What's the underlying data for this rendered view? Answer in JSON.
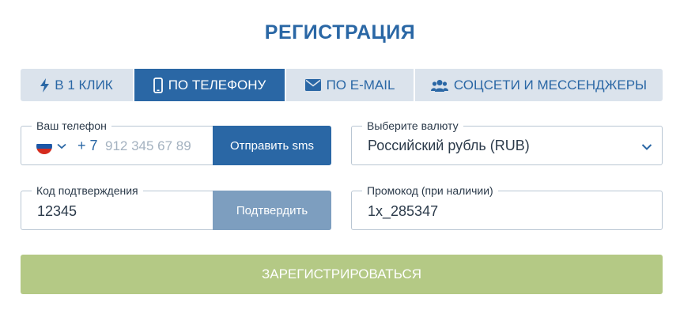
{
  "title": "РЕГИСТРАЦИЯ",
  "tabs": [
    {
      "label": "В 1 КЛИК",
      "icon": "lightning-icon",
      "active": false
    },
    {
      "label": "ПО ТЕЛЕФОНУ",
      "icon": "mobile-phone-icon",
      "active": true
    },
    {
      "label": "ПО E-MAIL",
      "icon": "envelope-icon",
      "active": false
    },
    {
      "label": "СОЦСЕТИ И МЕССЕНДЖЕРЫ",
      "icon": "users-icon",
      "active": false
    }
  ],
  "phone": {
    "label": "Ваш телефон",
    "country_flag": "russia-flag-icon",
    "prefix": "+ 7",
    "placeholder": "912 345 67 89",
    "value": "",
    "sms_button": "Отправить sms"
  },
  "currency": {
    "label": "Выберите валюту",
    "selected": "Российский рубль (RUB)"
  },
  "confirmation": {
    "label": "Код подтверждения",
    "value": "12345",
    "confirm_button": "Подтвердить"
  },
  "promo": {
    "label": "Промокод (при наличии)",
    "value": "1x_285347"
  },
  "register_button": "ЗАРЕГИСТРИРОВАТЬСЯ",
  "colors": {
    "primary": "#2a67a5",
    "tab_bg": "#dbe3ec",
    "confirm_disabled": "#7d9ebf",
    "register_bg": "#b4c985",
    "border": "#b9c6d3"
  }
}
